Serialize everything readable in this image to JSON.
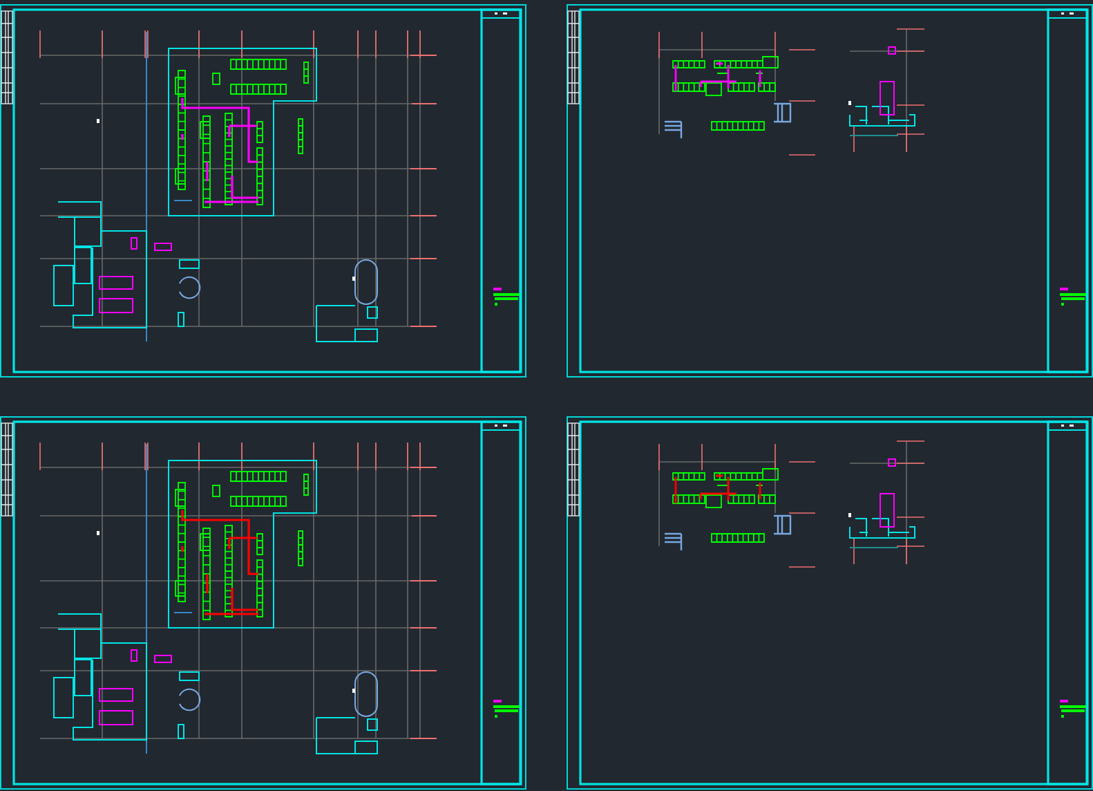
{
  "sheets": [
    {
      "kind": "floor-plan",
      "color": "#ff00ff"
    },
    {
      "kind": "detail-plan",
      "color": "#ff00ff"
    },
    {
      "kind": "floor-plan",
      "color": "#ff0000"
    },
    {
      "kind": "detail-plan",
      "color": "#ff0000"
    }
  ]
}
